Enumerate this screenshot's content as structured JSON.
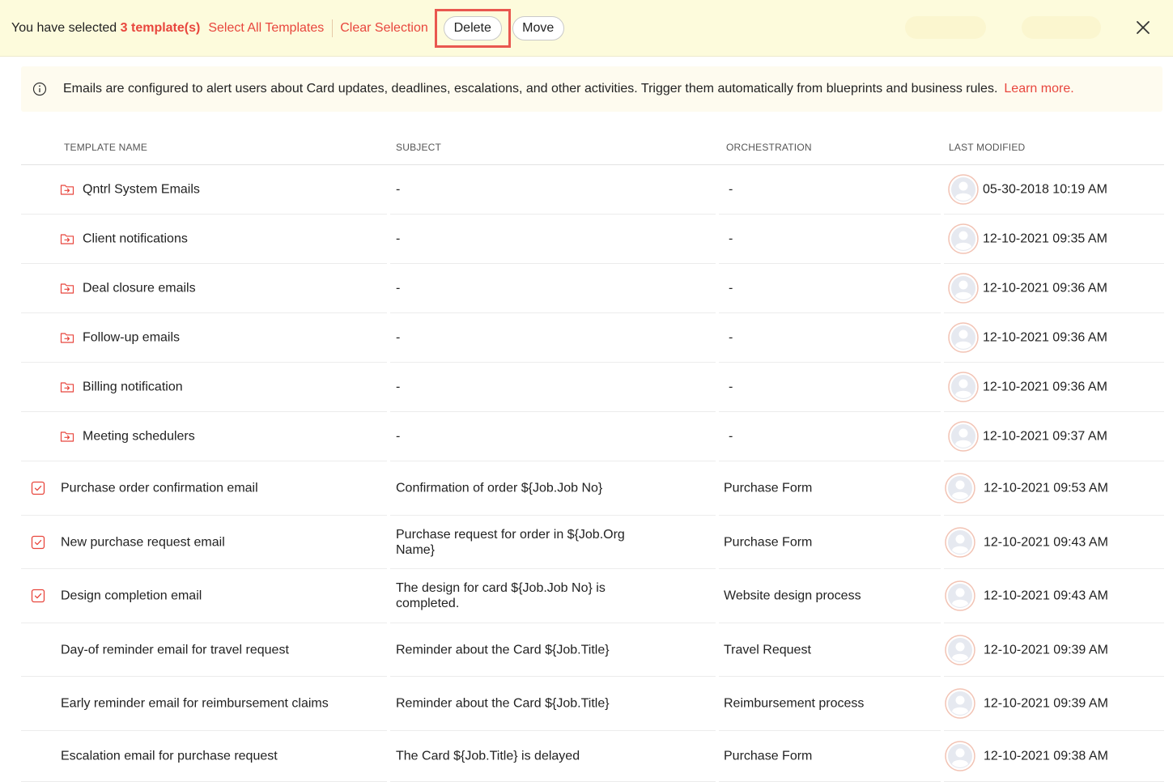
{
  "selection_bar": {
    "prefix": "You have selected",
    "count": "3 template(s)",
    "select_all": "Select All Templates",
    "clear": "Clear Selection",
    "delete": "Delete",
    "move": "Move"
  },
  "info": {
    "message": "Emails are configured to alert users about Card updates, deadlines, escalations, and other activities. Trigger them automatically from blueprints and business rules.",
    "link": "Learn more."
  },
  "colors": {
    "accent": "#e8463d",
    "selection_bar_bg": "#fdfbdc",
    "highlight_border": "#e9574f"
  },
  "table": {
    "headers": [
      "TEMPLATE NAME",
      "SUBJECT",
      "ORCHESTRATION",
      "LAST MODIFIED"
    ],
    "rows": [
      {
        "kind": "folder",
        "name": "Qntrl System Emails",
        "subject": "-",
        "orchestration": "-",
        "modified": "05-30-2018 10:19 AM"
      },
      {
        "kind": "folder",
        "name": "Client notifications",
        "subject": "-",
        "orchestration": "-",
        "modified": "12-10-2021 09:35 AM"
      },
      {
        "kind": "folder",
        "name": "Deal closure emails",
        "subject": "-",
        "orchestration": "-",
        "modified": "12-10-2021 09:36 AM"
      },
      {
        "kind": "folder",
        "name": "Follow-up emails",
        "subject": "-",
        "orchestration": "-",
        "modified": "12-10-2021 09:36 AM"
      },
      {
        "kind": "folder",
        "name": "Billing notification",
        "subject": "-",
        "orchestration": "-",
        "modified": "12-10-2021 09:36 AM"
      },
      {
        "kind": "folder",
        "name": "Meeting schedulers",
        "subject": "-",
        "orchestration": "-",
        "modified": "12-10-2021 09:37 AM"
      },
      {
        "kind": "template",
        "checked": true,
        "name": "Purchase order confirmation email",
        "subject": "Confirmation of order ${Job.Job No}",
        "orchestration": "Purchase Form",
        "modified": "12-10-2021 09:53 AM"
      },
      {
        "kind": "template",
        "checked": true,
        "name": "New purchase request email",
        "subject": "Purchase request for order in ${Job.Org Name}",
        "orchestration": "Purchase Form",
        "modified": "12-10-2021 09:43 AM"
      },
      {
        "kind": "template",
        "checked": true,
        "name": "Design completion email",
        "subject": "The design for card ${Job.Job No} is completed.",
        "orchestration": "Website design process",
        "modified": "12-10-2021 09:43 AM"
      },
      {
        "kind": "template",
        "checked": false,
        "name": "Day-of reminder email for travel request",
        "subject": "Reminder about the Card ${Job.Title}",
        "orchestration": "Travel Request",
        "modified": "12-10-2021 09:39 AM"
      },
      {
        "kind": "template",
        "checked": false,
        "name": "Early reminder email for reimbursement claims",
        "subject": "Reminder about the Card ${Job.Title}",
        "orchestration": "Reimbursement process",
        "modified": "12-10-2021 09:39 AM"
      },
      {
        "kind": "template",
        "checked": false,
        "name": "Escalation email for purchase request",
        "subject": "The Card ${Job.Title} is delayed",
        "orchestration": "Purchase Form",
        "modified": "12-10-2021 09:38 AM"
      }
    ]
  }
}
